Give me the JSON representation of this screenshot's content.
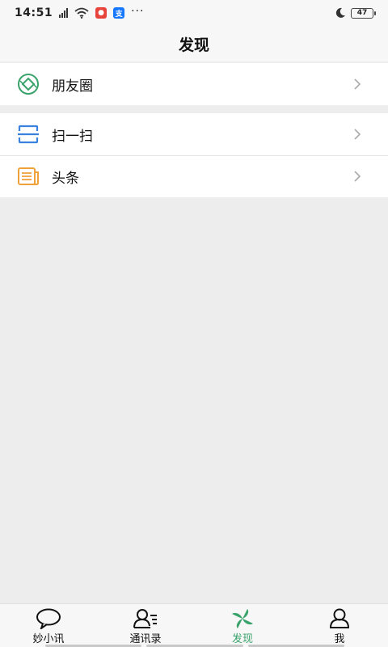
{
  "status_bar": {
    "time": "14:51",
    "network": "4G",
    "battery": "47",
    "more": "···"
  },
  "header": {
    "title": "发现"
  },
  "groups": [
    {
      "items": [
        {
          "label": "朋友圈",
          "icon": "moments-icon",
          "color": "#3aa36b"
        }
      ]
    },
    {
      "items": [
        {
          "label": "扫一扫",
          "icon": "scan-icon",
          "color": "#3b82e0"
        },
        {
          "label": "头条",
          "icon": "news-icon",
          "color": "#f0a23a"
        }
      ]
    }
  ],
  "tabs": [
    {
      "label": "妙小讯",
      "icon": "chat-icon",
      "active": false
    },
    {
      "label": "通讯录",
      "icon": "contacts-icon",
      "active": false
    },
    {
      "label": "发现",
      "icon": "discover-icon",
      "active": true
    },
    {
      "label": "我",
      "icon": "profile-icon",
      "active": false
    }
  ],
  "colors": {
    "accent": "#3aa36b",
    "background": "#ededed",
    "bar": "#f7f7f7"
  }
}
